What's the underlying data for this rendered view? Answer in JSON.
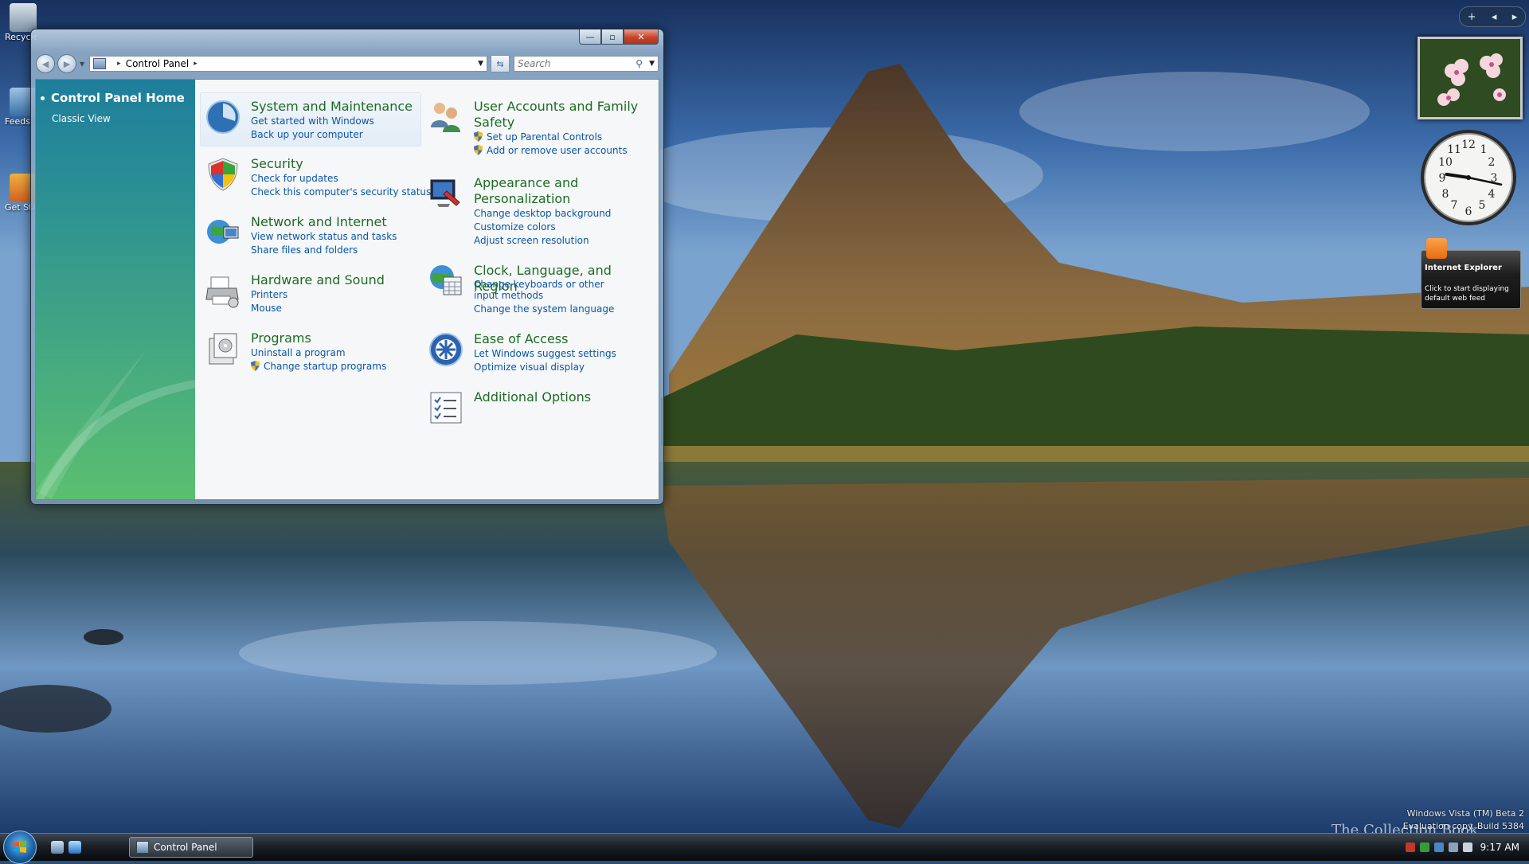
{
  "desktop": {
    "icons": [
      {
        "label": "Recycle Bin"
      },
      {
        "label": "Feeds"
      },
      {
        "label": "Get Started"
      }
    ]
  },
  "window": {
    "caption_buttons": {
      "minimize": "—",
      "maximize": "▫",
      "close": "✕"
    },
    "address": {
      "segments": [
        "Control Panel"
      ]
    },
    "search": {
      "placeholder": "Search"
    },
    "sidebar": {
      "home": "Control Panel Home",
      "classic": "Classic View"
    },
    "categories": [
      {
        "title": "System and Maintenance",
        "links": [
          "Get started with Windows",
          "Back up your computer"
        ]
      },
      {
        "title": "Security",
        "links": [
          "Check for updates",
          "Check this computer's security status"
        ]
      },
      {
        "title": "Network and Internet",
        "links": [
          "View network status and tasks",
          "Share files and folders"
        ]
      },
      {
        "title": "Hardware and Sound",
        "links": [
          "Printers",
          "Mouse"
        ]
      },
      {
        "title": "Programs",
        "links": [
          "Uninstall a program",
          "Change startup programs"
        ]
      },
      {
        "title": "User Accounts and Family Safety",
        "links": [
          "Set up Parental Controls",
          "Add or remove user accounts"
        ]
      },
      {
        "title": "Appearance and Personalization",
        "links": [
          "Change desktop background",
          "Customize colors",
          "Adjust screen resolution"
        ]
      },
      {
        "title": "Clock, Language, and Region",
        "links": [
          "Change keyboards or other input methods",
          "Change the system language"
        ]
      },
      {
        "title": "Ease of Access",
        "links": [
          "Let Windows suggest settings",
          "Optimize visual display"
        ]
      },
      {
        "title": "Additional Options",
        "links": []
      }
    ]
  },
  "gadgets": {
    "top_bar": {
      "add": "+",
      "prev": "◂",
      "next": "▸"
    },
    "feed": {
      "title": "Internet Explorer",
      "text": "Click to start displaying default web feed"
    },
    "clock": {
      "hour": 9,
      "minute": 17
    }
  },
  "watermark": {
    "line1": "Windows Vista (TM) Beta 2",
    "line2": "Evaluation copy. Build 5384",
    "brand": "The Collection Book"
  },
  "taskbar": {
    "task_label": "Control Panel",
    "time": "9:17 AM"
  },
  "colors": {
    "category_title": "#1f6a25",
    "link": "#0b55a8",
    "sidebar_top": "#1e7e9c",
    "sidebar_bottom": "#5bbf70"
  }
}
